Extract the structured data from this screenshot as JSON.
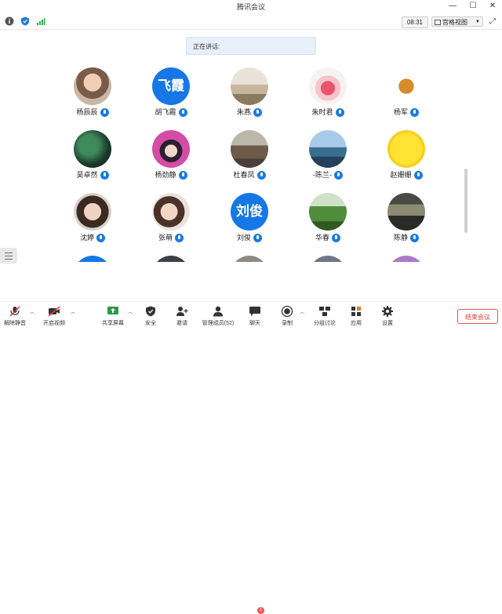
{
  "window": {
    "title": "腾讯会议"
  },
  "status": {
    "time": "08:31",
    "view_label": "宫格视图"
  },
  "speaking_label": "正在讲话:",
  "participants": [
    {
      "name": "杨辰辰",
      "avatar": "photo"
    },
    {
      "name": "胡飞霞",
      "avatar": "text",
      "avatar_text": "飞霞"
    },
    {
      "name": "朱燕",
      "avatar": "photo"
    },
    {
      "name": "朱时君",
      "avatar": "photo"
    },
    {
      "name": "杨军",
      "avatar": "photo"
    },
    {
      "name": "吴卓然",
      "avatar": "photo"
    },
    {
      "name": "杨劲静",
      "avatar": "photo"
    },
    {
      "name": "杜春凤",
      "avatar": "photo"
    },
    {
      "name": "-陈兰-",
      "avatar": "photo"
    },
    {
      "name": "赵姗姗",
      "avatar": "photo"
    },
    {
      "name": "沈婷",
      "avatar": "photo"
    },
    {
      "name": "张萌",
      "avatar": "photo"
    },
    {
      "name": "刘俊",
      "avatar": "text",
      "avatar_text": "刘俊"
    },
    {
      "name": "华春",
      "avatar": "photo"
    },
    {
      "name": "陈静",
      "avatar": "photo"
    }
  ],
  "toolbar": {
    "unmute": "解除静音",
    "start_video": "开启视频",
    "share_screen": "共享屏幕",
    "security": "安全",
    "invite": "邀请",
    "members": "管理成员(52)",
    "chat": "聊天",
    "chat_badge": "1",
    "record": "录制",
    "breakout": "分组讨论",
    "apps": "应用",
    "settings": "设置",
    "end_meeting": "结束会议"
  },
  "colors": {
    "accent": "#1677e6",
    "end": "#e03b3b",
    "badge": "#f25353"
  }
}
